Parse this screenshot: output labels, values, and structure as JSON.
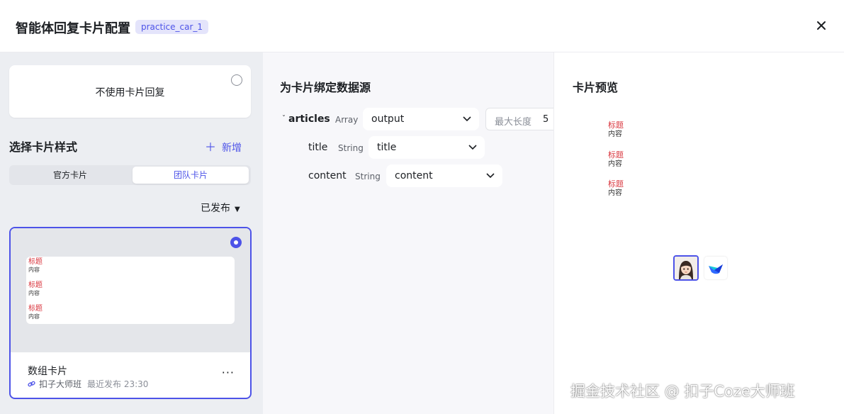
{
  "header": {
    "title": "智能体回复卡片配置",
    "tag": "practice_car_1",
    "close_icon": "close-icon"
  },
  "left": {
    "no_card_label": "不使用卡片回复",
    "section_title": "选择卡片样式",
    "add_label": "新增",
    "add_icon": "plus-icon",
    "tabs": [
      {
        "label": "官方卡片",
        "active": false
      },
      {
        "label": "团队卡片",
        "active": true
      }
    ],
    "filter_label": "已发布",
    "card": {
      "preview_items": [
        {
          "title": "标题",
          "content": "内容"
        },
        {
          "title": "标题",
          "content": "内容"
        },
        {
          "title": "标题",
          "content": "内容"
        }
      ],
      "name": "数组卡片",
      "owner": "扣子大师班",
      "publish_time": "最近发布 23:30",
      "more": "···"
    }
  },
  "middle": {
    "title": "为卡片绑定数据源",
    "rows": [
      {
        "name": "articles",
        "type": "Array",
        "value": "output"
      },
      {
        "name": "title",
        "type": "String",
        "value": "title"
      },
      {
        "name": "content",
        "type": "String",
        "value": "content"
      }
    ],
    "max_length_label": "最大长度",
    "max_length_value": "5"
  },
  "right": {
    "title": "卡片预览",
    "preview_items": [
      {
        "title": "标题",
        "content": "内容"
      },
      {
        "title": "标题",
        "content": "内容"
      },
      {
        "title": "标题",
        "content": "内容"
      }
    ]
  },
  "watermark": "掘金技术社区 @ 扣子Coze大师班",
  "colors": {
    "accent": "#4d53e8",
    "title_red": "#d9363e",
    "left_bg": "#eceef2"
  }
}
